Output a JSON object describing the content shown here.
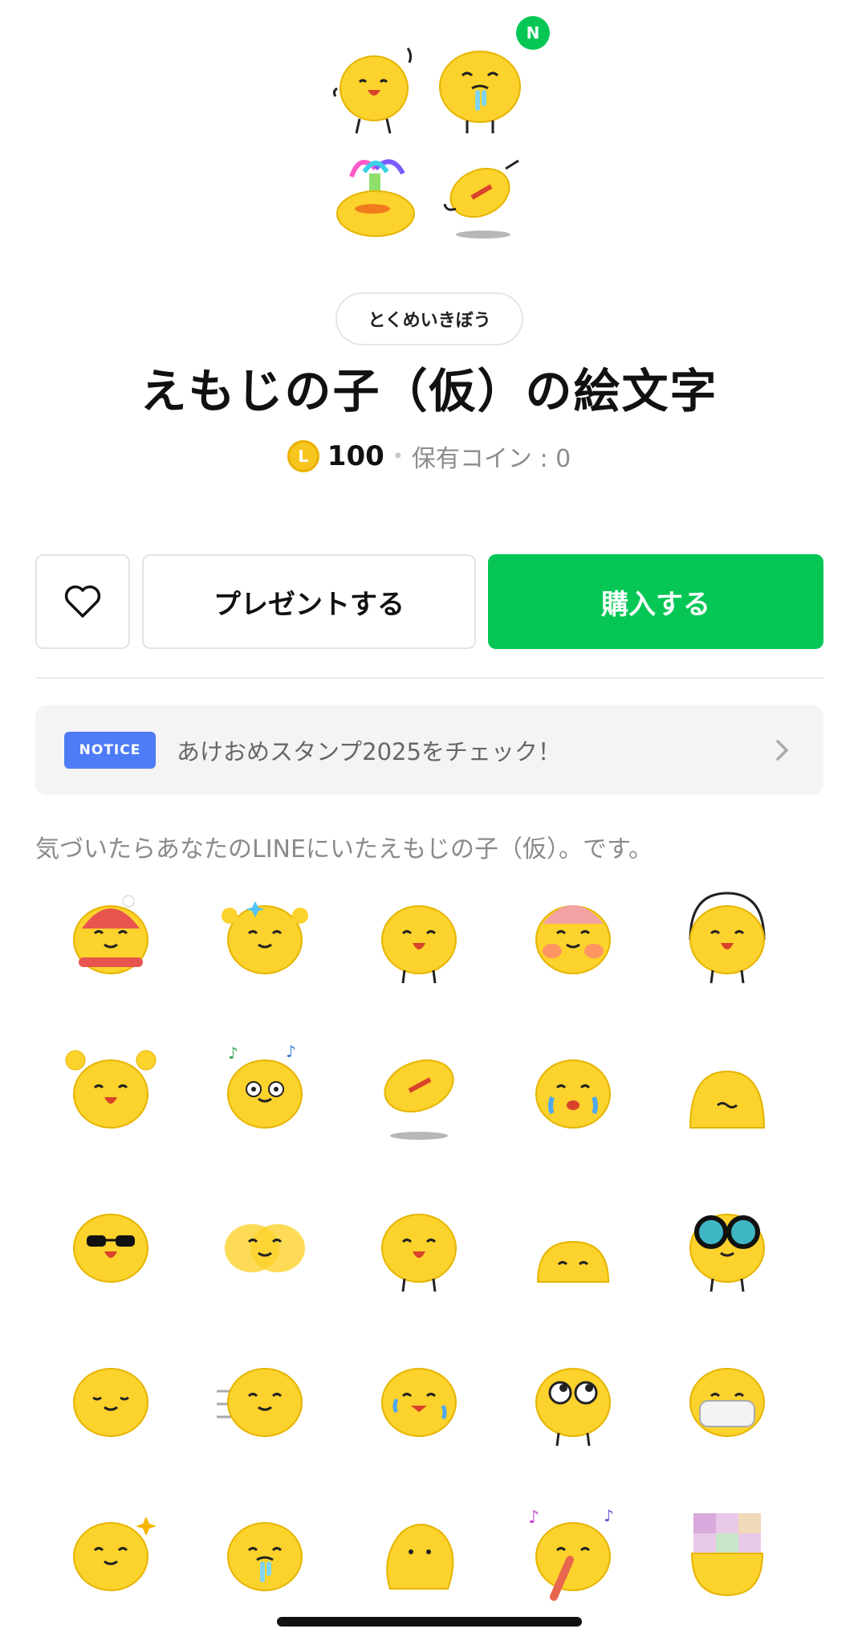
{
  "hero": {
    "new_badge": "N",
    "preview_emojis": [
      "wave-emoji",
      "drool-emoji",
      "rainbow-fountain-emoji",
      "jump-emoji"
    ]
  },
  "author": "とくめいきぼう",
  "title": "えもじの子（仮）の絵文字",
  "price": {
    "coin_symbol": "L",
    "amount": "100",
    "separator": "•",
    "owned_label": "保有コイン : 0"
  },
  "actions": {
    "favorite_icon": "heart-outline-icon",
    "present_label": "プレゼントする",
    "buy_label": "購入する"
  },
  "notice": {
    "badge": "NOTICE",
    "text": "あけおめスタンプ2025をチェック！",
    "chevron_icon": "chevron-right-icon"
  },
  "description": "気づいたらあなたのLINEにいたえもじの子（仮）。です。",
  "colors": {
    "line_green": "#06c755",
    "emoji_yellow": "#fcd22c",
    "notice_blue": "#4e7cf6",
    "coin_gold": "#f7c51e"
  },
  "emoji_grid": [
    [
      "winter-hat-scarf-emoji",
      "thumbs-up-sparkle-emoji",
      "wave-emoji",
      "blush-mittens-emoji",
      "arms-circle-emoji"
    ],
    [
      "hands-up-cheer-emoji",
      "music-dance-emoji",
      "running-jump-emoji",
      "crying-shock-emoji",
      "hiding-emoji"
    ],
    [
      "sunglasses-point-emoji",
      "shaking-blur-emoji",
      "tongue-tilt-emoji",
      "peeking-emoji",
      "binoculars-emoji"
    ],
    [
      "steam-calm-emoji",
      "speed-dash-emoji",
      "sweating-thumb-emoji",
      "rolling-eyes-emoji",
      "face-mask-emoji"
    ],
    [
      "flex-sparkle-emoji",
      "drool-emoji",
      "blob-melt-emoji",
      "singing-tongue-emoji",
      "mosaic-censored-emoji"
    ]
  ]
}
